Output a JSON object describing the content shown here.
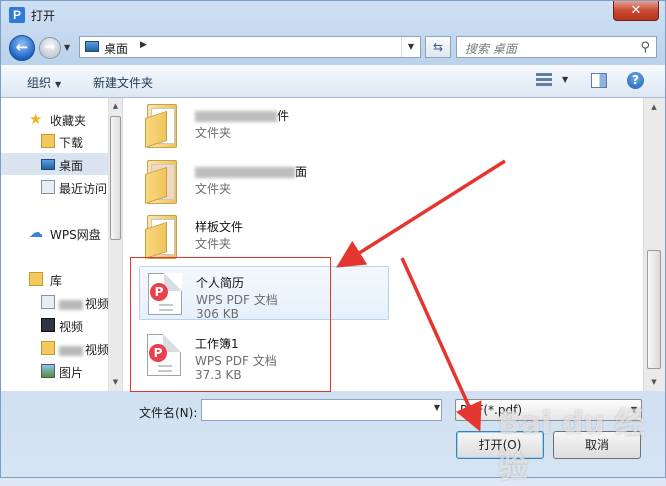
{
  "window": {
    "title": "打开",
    "app_icon_glyph": "P",
    "close_glyph": "✕"
  },
  "nav": {
    "back_glyph": "←",
    "forward_glyph": "→",
    "address": "桌面",
    "address_arrow": "▶",
    "search_placeholder": "搜索 桌面"
  },
  "toolbar": {
    "organize": "组织",
    "new_folder": "新建文件夹",
    "help_glyph": "?"
  },
  "sidebar": {
    "favorites": "收藏夹",
    "downloads": "下载",
    "desktop": "桌面",
    "recent": "最近访问",
    "wps_cloud": "WPS网盘",
    "libraries": "库",
    "documents_suffix": "视频",
    "videos": "视频",
    "thunder_suffix": "视频",
    "pictures": "图片"
  },
  "files": [
    {
      "name_suffix": "件",
      "type": "文件夹",
      "kind": "folder"
    },
    {
      "name_suffix": "面",
      "type": "文件夹",
      "kind": "folder"
    },
    {
      "name": "样板文件",
      "type": "文件夹",
      "kind": "folder"
    },
    {
      "name": "个人简历",
      "type": "WPS PDF 文档",
      "size": "306 KB",
      "kind": "pdf"
    },
    {
      "name": "工作簿1",
      "type": "WPS PDF 文档",
      "size": "37.3 KB",
      "kind": "pdf"
    }
  ],
  "bottom": {
    "filename_label": "文件名(N):",
    "filename_value": "",
    "filetype": "PDF(*.pdf)",
    "open_button": "打开(O)",
    "cancel_button": "取消"
  },
  "colors": {
    "annotation_red": "#e5352f",
    "accent_blue": "#1d65c5"
  },
  "watermark": "Bai du 经验"
}
